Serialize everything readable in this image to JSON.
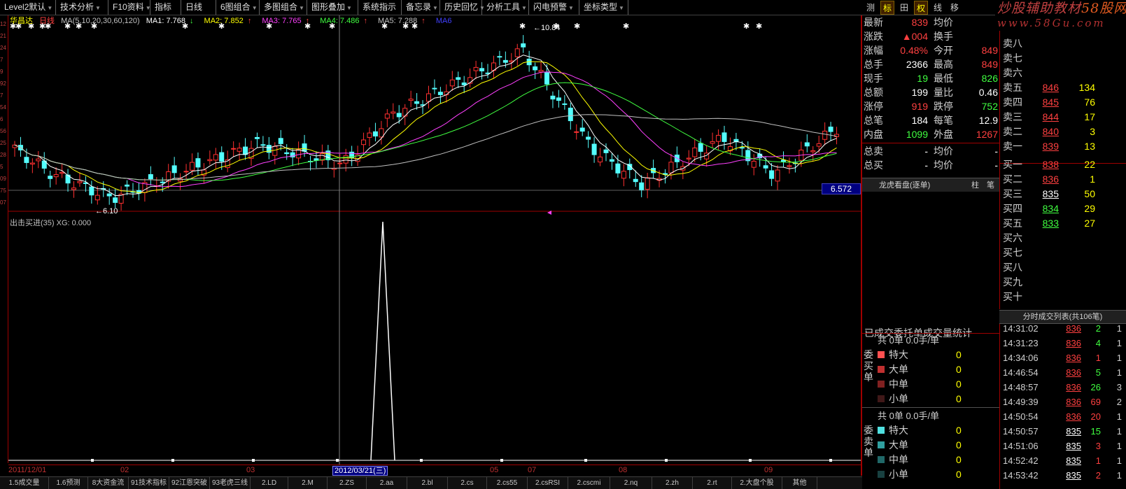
{
  "toolbar": {
    "buttons": [
      "Level2默认",
      "技术分析",
      "F10资料",
      "指标",
      "日线",
      "6图组合",
      "多图组合",
      "图形叠加",
      "系统指示",
      "备忘录",
      "历史回忆",
      "分析工具",
      "闪电预警",
      "坐标类型"
    ],
    "tabs": [
      "测",
      "标",
      "田",
      "权",
      "线",
      "移"
    ],
    "active_tabs": [
      "标",
      "权"
    ]
  },
  "brand": {
    "title": "炒股辅助教材",
    "title_suffix": "58股网",
    "url": "www.58Gu.com"
  },
  "kline_header": {
    "stock_name": "华昌达",
    "period": "日线",
    "ma_params": "MA(5,10,20,30,60,120)",
    "ma1": "MA1: 7.768",
    "ma2": "MA2: 7.852",
    "ma3": "MA3: 7.765",
    "ma4": "MA4: 7.486",
    "ma5": "MA5: 7.288",
    "ma6": "MA6"
  },
  "chart": {
    "colors": {
      "up": "#ff3030",
      "down": "#54ffff",
      "ma1": "#ffffff",
      "ma2": "#ffff00",
      "ma3": "#ff40ff",
      "ma4": "#40ff40",
      "ma5": "#c0c0c0",
      "ma6": "#4040ff"
    },
    "high_label": "10.84",
    "low_label": "6.10",
    "price_tag": "6.572"
  },
  "indicator_header": {
    "name": "出击买进(35)",
    "value": "XG: 0.000"
  },
  "date_axis": {
    "labels": [
      "2011/12/01",
      "02",
      "03",
      "05",
      "07",
      "08",
      "09"
    ],
    "cursor": "2012/03/21(三)"
  },
  "bottom_tabs": [
    "1.5成交量",
    "1.6预测",
    "8大资金流",
    "91技术指标",
    "92江恩突破",
    "93老虎三线",
    "2.LD",
    "2.M",
    "2.ZS",
    "2.aa",
    "2.bl",
    "2.cs",
    "2.cs55",
    "2.csRSI",
    "2.cscmi",
    "2.nq",
    "2.zh",
    "2.rt",
    "2.大盘个股",
    "其他"
  ],
  "quote": {
    "rows": [
      {
        "l1": "最新",
        "v1": "839",
        "c1": "red",
        "l2": "均价",
        "v2": "",
        "c2": "white"
      },
      {
        "l1": "涨跌",
        "v1": "▲004",
        "c1": "red",
        "l2": "换手",
        "v2": "",
        "c2": "white"
      },
      {
        "l1": "涨幅",
        "v1": "0.48%",
        "c1": "red",
        "l2": "今开",
        "v2": "849",
        "c2": "red"
      },
      {
        "l1": "总手",
        "v1": "2366",
        "c1": "white",
        "l2": "最高",
        "v2": "849",
        "c2": "red"
      },
      {
        "l1": "现手",
        "v1": "19",
        "c1": "green",
        "l2": "最低",
        "v2": "826",
        "c2": "green"
      },
      {
        "l1": "总额",
        "v1": "199",
        "c1": "white",
        "l2": "量比",
        "v2": "0.46",
        "c2": "white"
      },
      {
        "l1": "涨停",
        "v1": "919",
        "c1": "red",
        "l2": "跌停",
        "v2": "752",
        "c2": "green"
      },
      {
        "l1": "总笔",
        "v1": "184",
        "c1": "white",
        "l2": "每笔",
        "v2": "12.9",
        "c2": "white"
      },
      {
        "l1": "内盘",
        "v1": "1099",
        "c1": "green",
        "l2": "外盘",
        "v2": "1267",
        "c2": "red"
      },
      {
        "l1": "总卖",
        "v1": "-",
        "c1": "white",
        "l2": "均价",
        "v2": "-",
        "c2": "white"
      },
      {
        "l1": "总买",
        "v1": "-",
        "c1": "white",
        "l2": "均价",
        "v2": "-",
        "c2": "white"
      }
    ],
    "lhb_tab": "龙虎看盘(逐单)",
    "lhb_tab2": "柱",
    "lhb_tab3": "笔"
  },
  "order_book": {
    "sells": [
      {
        "label": "卖八",
        "price": "",
        "vol": ""
      },
      {
        "label": "卖七",
        "price": "",
        "vol": ""
      },
      {
        "label": "卖六",
        "price": "",
        "vol": ""
      },
      {
        "label": "卖五",
        "price": "846",
        "vol": "134"
      },
      {
        "label": "卖四",
        "price": "845",
        "vol": "76"
      },
      {
        "label": "卖三",
        "price": "844",
        "vol": "17"
      },
      {
        "label": "卖二",
        "price": "840",
        "vol": "3"
      },
      {
        "label": "卖一",
        "price": "839",
        "vol": "13"
      }
    ],
    "buys": [
      {
        "label": "买一",
        "price": "838",
        "vol": "22",
        "pc": "red"
      },
      {
        "label": "买二",
        "price": "836",
        "vol": "1",
        "pc": "red"
      },
      {
        "label": "买三",
        "price": "835",
        "vol": "50",
        "pc": "white"
      },
      {
        "label": "买四",
        "price": "834",
        "vol": "29",
        "pc": "green"
      },
      {
        "label": "买五",
        "price": "833",
        "vol": "27",
        "pc": "green"
      },
      {
        "label": "买六",
        "price": "",
        "vol": "",
        "pc": "white"
      },
      {
        "label": "买七",
        "price": "",
        "vol": "",
        "pc": "white"
      },
      {
        "label": "买八",
        "price": "",
        "vol": "",
        "pc": "white"
      },
      {
        "label": "买九",
        "price": "",
        "vol": "",
        "pc": "white"
      },
      {
        "label": "买十",
        "price": "",
        "vol": "",
        "pc": "white"
      }
    ]
  },
  "trades": {
    "header": "分时成交列表(共106笔)",
    "rows": [
      {
        "time": "14:31:02",
        "price": "836",
        "vol": "2",
        "cnt": "1",
        "pc": "red",
        "vc": "green"
      },
      {
        "time": "14:31:23",
        "price": "836",
        "vol": "4",
        "cnt": "1",
        "pc": "red",
        "vc": "green"
      },
      {
        "time": "14:34:06",
        "price": "836",
        "vol": "1",
        "cnt": "1",
        "pc": "red",
        "vc": "red"
      },
      {
        "time": "14:46:54",
        "price": "836",
        "vol": "5",
        "cnt": "1",
        "pc": "red",
        "vc": "green"
      },
      {
        "time": "14:48:57",
        "price": "836",
        "vol": "26",
        "cnt": "3",
        "pc": "red",
        "vc": "green"
      },
      {
        "time": "14:49:39",
        "price": "836",
        "vol": "69",
        "cnt": "2",
        "pc": "red",
        "vc": "red"
      },
      {
        "time": "14:50:54",
        "price": "836",
        "vol": "20",
        "cnt": "1",
        "pc": "red",
        "vc": "red"
      },
      {
        "time": "14:50:57",
        "price": "835",
        "vol": "15",
        "cnt": "1",
        "pc": "white",
        "vc": "green"
      },
      {
        "time": "14:51:06",
        "price": "835",
        "vol": "3",
        "cnt": "1",
        "pc": "white",
        "vc": "red"
      },
      {
        "time": "14:52:42",
        "price": "835",
        "vol": "1",
        "cnt": "1",
        "pc": "white",
        "vc": "red"
      },
      {
        "time": "14:53:42",
        "price": "835",
        "vol": "2",
        "cnt": "1",
        "pc": "white",
        "vc": "red"
      }
    ]
  },
  "stats": {
    "title": "已成交委托单成交量统计",
    "buy_side": "委买单",
    "sell_side": "委卖单",
    "buy_head": "共 0单 0.0手/单",
    "sell_head": "共 0单 0.0手/单",
    "buy_rows": [
      {
        "label": "特大",
        "value": "0",
        "color": "#ff5050"
      },
      {
        "label": "大单",
        "value": "0",
        "color": "#c03030"
      },
      {
        "label": "中单",
        "value": "0",
        "color": "#802020"
      },
      {
        "label": "小单",
        "value": "0",
        "color": "#401818"
      }
    ],
    "sell_rows": [
      {
        "label": "特大",
        "value": "0",
        "color": "#50e0e0"
      },
      {
        "label": "大单",
        "value": "0",
        "color": "#30a0a0"
      },
      {
        "label": "中单",
        "value": "0",
        "color": "#206868"
      },
      {
        "label": "小单",
        "value": "0",
        "color": "#184040"
      }
    ]
  },
  "left_scale": [
    "12",
    "21",
    "24",
    "7",
    "9",
    "92",
    "7",
    "54",
    "6",
    "56",
    "25",
    "28",
    "5",
    "09",
    "75",
    "07"
  ]
}
